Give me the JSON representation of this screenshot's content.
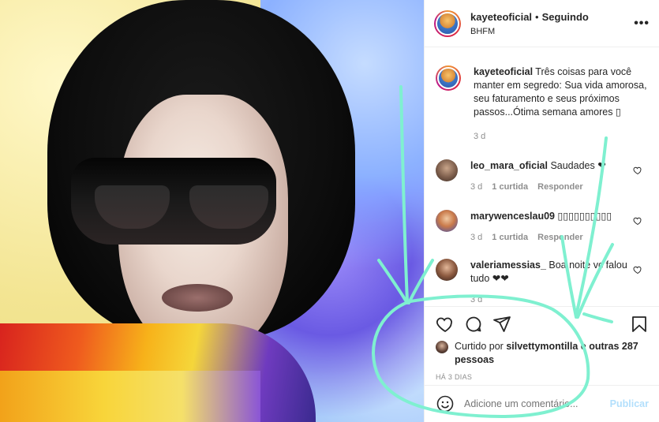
{
  "post": {
    "username": "kayeteoficial",
    "separator": "•",
    "follow_status": "Seguindo",
    "location": "BHFM",
    "more_icon": "more-options-icon",
    "more_glyph": "•••"
  },
  "caption": {
    "username": "kayeteoficial",
    "text": " Três coisas para você manter em segredo: Sua vida amorosa, seu faturamento e seus próximos passos...Ótima semana amores ",
    "emoji": "▯",
    "time": "3 d"
  },
  "comments": [
    {
      "username": "leo_mara_oficial",
      "text": " Saudades ❤",
      "time": "3 d",
      "likes": "1 curtida",
      "reply": "Responder"
    },
    {
      "username": "marywenceslau09",
      "text": " ▯▯▯▯▯▯▯▯▯▯",
      "time": "3 d",
      "likes": "1 curtida",
      "reply": "Responder"
    },
    {
      "username": "valeriamessias_",
      "text": " Boa noite vc falou tudo ❤❤",
      "time": "3 d",
      "likes": "",
      "reply": ""
    }
  ],
  "actions": {
    "like_icon": "heart-icon",
    "comment_icon": "comment-icon",
    "share_icon": "send-icon",
    "save_icon": "bookmark-icon"
  },
  "likes": {
    "prefix": "Curtido por ",
    "user": "silvettymontilla",
    "middle": " e ",
    "others": "outras 287 pessoas"
  },
  "time_ago": "HÁ 3 DIAS",
  "add_comment": {
    "placeholder": "Adicione um comentário...",
    "publish_label": "Publicar",
    "emoji_icon": "smiley-icon"
  },
  "colors": {
    "doodle": "#7ff0d0",
    "publish": "#b2dffc",
    "muted": "#8e8e8e"
  }
}
